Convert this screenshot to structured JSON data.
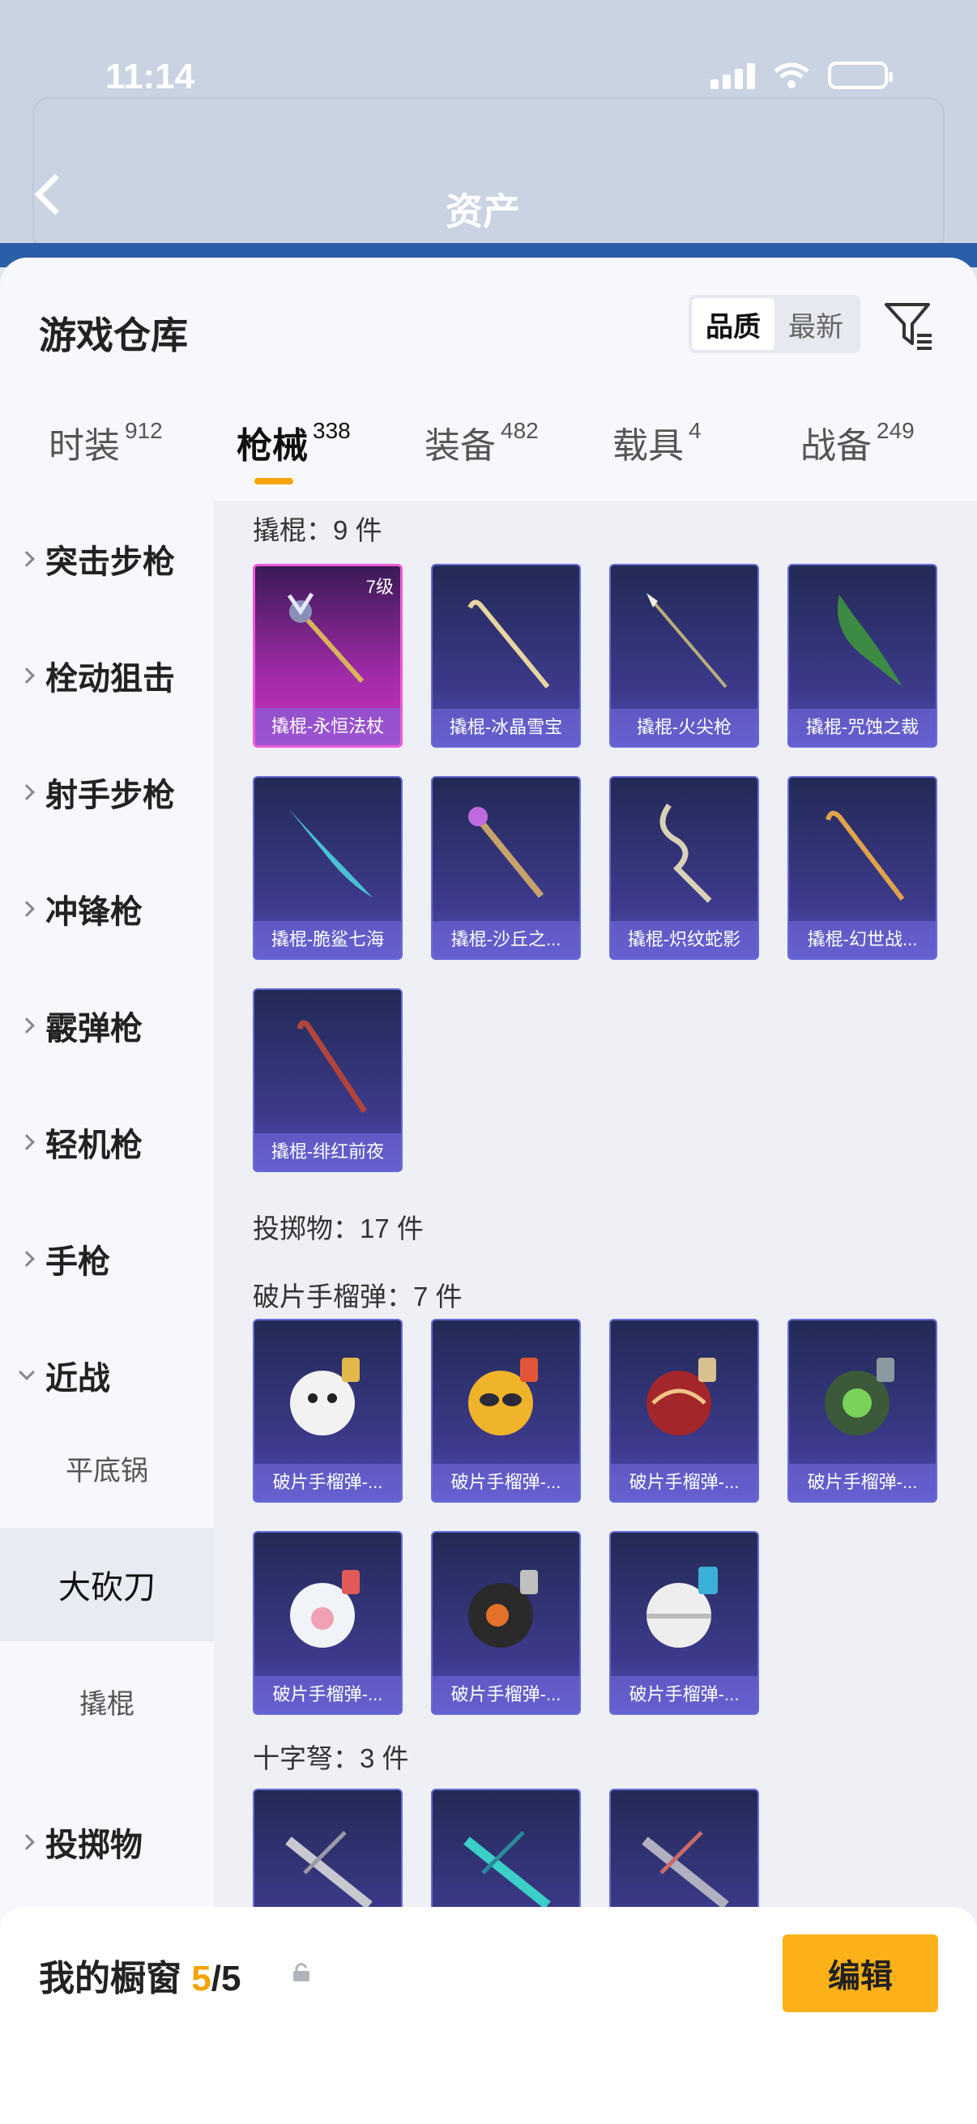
{
  "status": {
    "time": "11:14"
  },
  "background_page": {
    "title": "资产"
  },
  "sheet": {
    "title": "游戏仓库",
    "sort": {
      "options": [
        "品质",
        "最新"
      ],
      "active": "品质"
    },
    "tabs": [
      {
        "label": "时装",
        "count": "912"
      },
      {
        "label": "枪械",
        "count": "338",
        "active": true
      },
      {
        "label": "装备",
        "count": "482"
      },
      {
        "label": "载具",
        "count": "4"
      },
      {
        "label": "战备",
        "count": "249"
      }
    ]
  },
  "categories": {
    "items": [
      "突击步枪",
      "栓动狙击",
      "射手步枪",
      "冲锋枪",
      "霰弹枪",
      "轻机枪",
      "手枪",
      "近战"
    ],
    "sub_items": [
      "平底锅",
      "大砍刀",
      "撬棍"
    ],
    "active_sub": "大砍刀",
    "tail": "投掷物"
  },
  "sections": {
    "crowbar": {
      "title": "撬棍：9 件"
    },
    "throwables": {
      "title": "投掷物：17 件"
    },
    "frag": {
      "title": "破片手榴弹：7 件"
    },
    "crossbow": {
      "title": "十字弩：3 件"
    }
  },
  "crowbar_items": [
    {
      "name": "撬棍-永恒法杖",
      "level": "7级",
      "rarity": "legendary"
    },
    {
      "name": "撬棍-冰晶雪宝"
    },
    {
      "name": "撬棍-火尖枪"
    },
    {
      "name": "撬棍-咒蚀之裁"
    },
    {
      "name": "撬棍-脆鲨七海"
    },
    {
      "name": "撬棍-沙丘之..."
    },
    {
      "name": "撬棍-炽纹蛇影"
    },
    {
      "name": "撬棍-幻世战..."
    },
    {
      "name": "撬棍-绯红前夜"
    }
  ],
  "frag_items": [
    {
      "name": "破片手榴弹-..."
    },
    {
      "name": "破片手榴弹-..."
    },
    {
      "name": "破片手榴弹-..."
    },
    {
      "name": "破片手榴弹-..."
    },
    {
      "name": "破片手榴弹-..."
    },
    {
      "name": "破片手榴弹-..."
    },
    {
      "name": "破片手榴弹-..."
    }
  ],
  "showcase": {
    "label": "我的橱窗",
    "current": "5",
    "separator": "/",
    "max": "5",
    "edit_label": "编辑"
  },
  "colors": {
    "accent": "#FBB117",
    "legendary": "#CC35B8",
    "card": "#3D3A8C"
  }
}
